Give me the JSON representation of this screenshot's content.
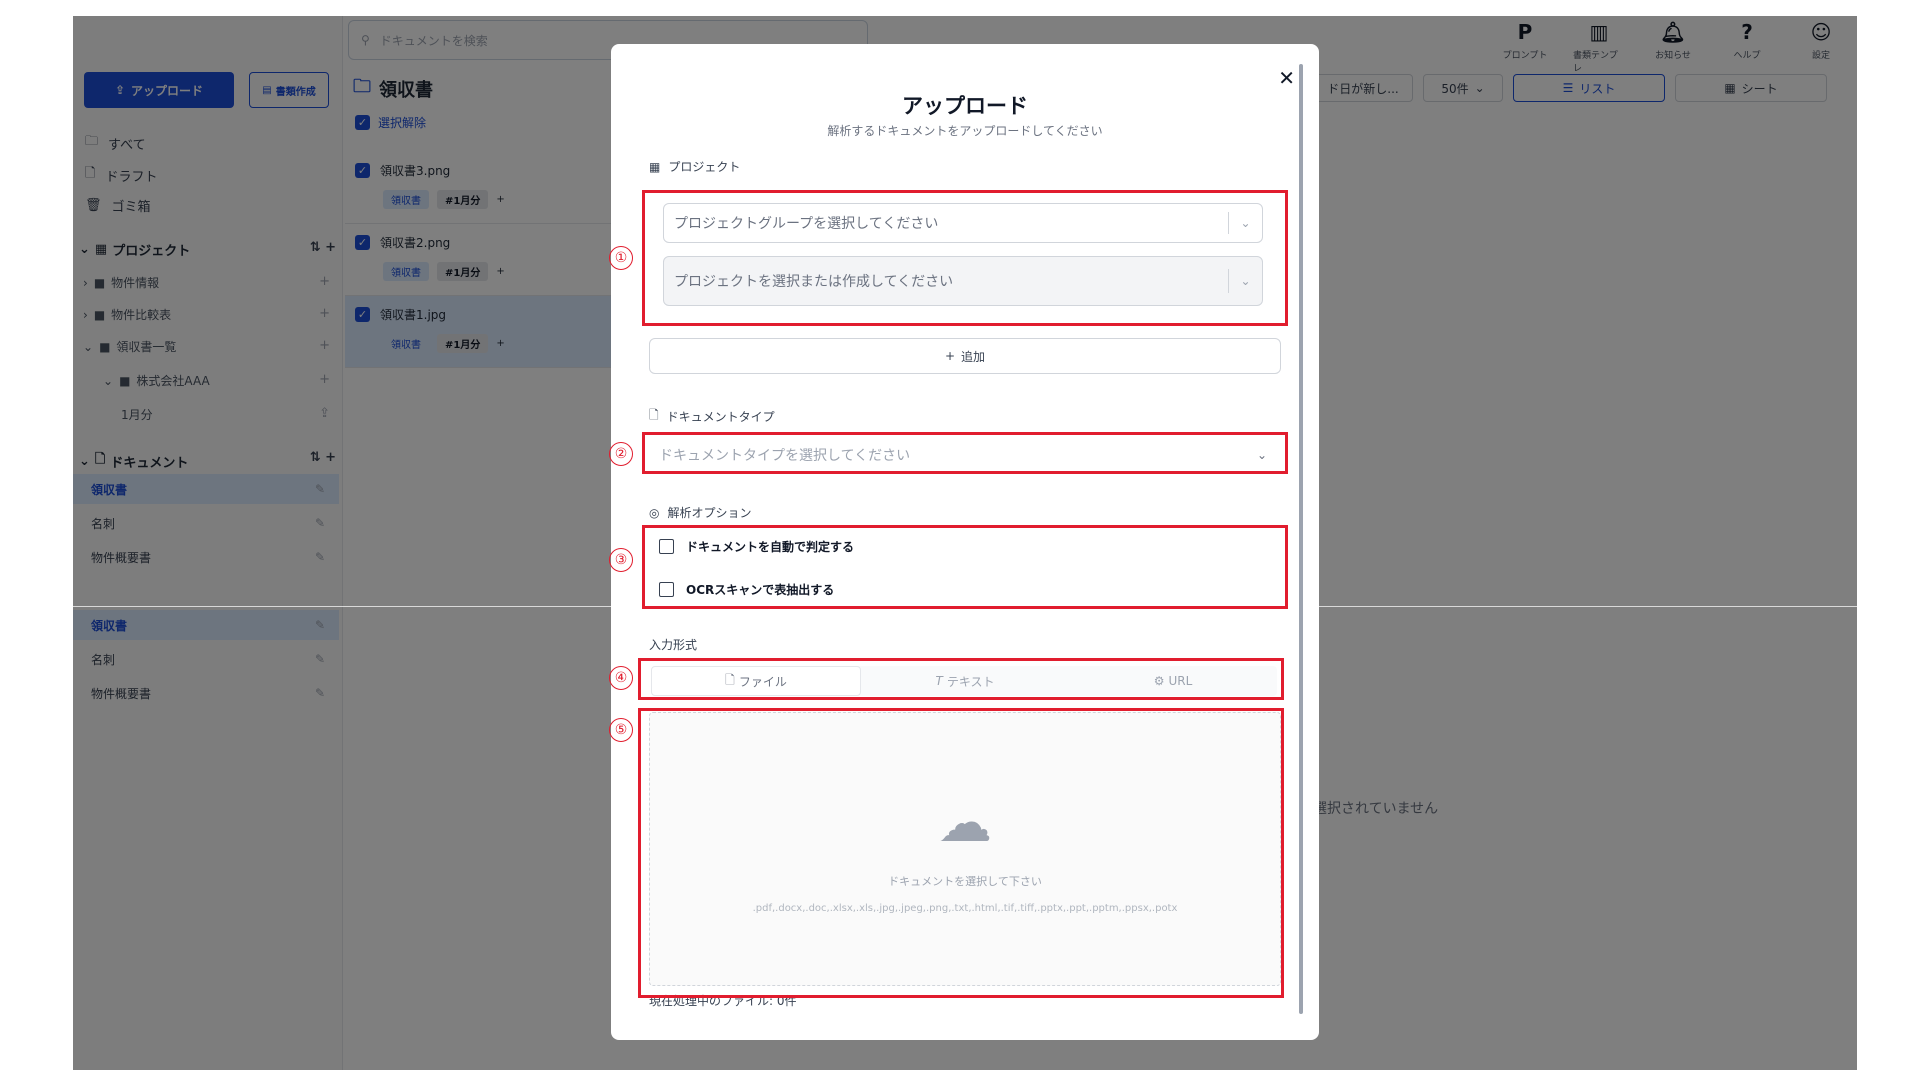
{
  "sidebar": {
    "upload_label": "アップロード",
    "create_label": "書類作成",
    "nav": [
      {
        "label": "すべて",
        "icon": "folder-icon"
      },
      {
        "label": "ドラフト",
        "icon": "file-icon"
      },
      {
        "label": "ゴミ箱",
        "icon": "trash-icon"
      }
    ],
    "projects_header": "プロジェクト",
    "projects_actions": "⇅ +",
    "tree": [
      {
        "label": "物件情報"
      },
      {
        "label": "物件比較表"
      },
      {
        "label": "領収書一覧"
      },
      {
        "label": "株式会社AAA"
      },
      {
        "label": "1月分"
      }
    ],
    "documents_header": "ドキュメント",
    "documents_actions": "⇅ +",
    "documents": [
      {
        "label": "領収書"
      },
      {
        "label": "名刺"
      },
      {
        "label": "物件概要書"
      }
    ],
    "documents_dup": [
      {
        "label": "領収書"
      },
      {
        "label": "名刺"
      },
      {
        "label": "物件概要書"
      }
    ]
  },
  "search": {
    "placeholder": "ドキュメントを検索"
  },
  "middle": {
    "folder_title": "領収書",
    "deselect_label": "選択解除",
    "files": [
      {
        "name": "領収書3.png",
        "tag1": "領収書",
        "tag2": "#1月分",
        "plus": "+"
      },
      {
        "name": "領収書2.png",
        "tag1": "領収書",
        "tag2": "#1月分",
        "plus": "+"
      },
      {
        "name": "領収書1.jpg",
        "tag1": "領収書",
        "tag2": "#1月分",
        "plus": "+"
      }
    ]
  },
  "topbar": {
    "icons": [
      {
        "label": "プロンプト",
        "glyph": "P",
        "icon": "prompt-icon"
      },
      {
        "label": "書類テンプレ",
        "glyph": "▥",
        "icon": "template-icon"
      },
      {
        "label": "お知らせ",
        "glyph": "🔔︎",
        "icon": "bell-icon"
      },
      {
        "label": "ヘルプ",
        "glyph": "?",
        "icon": "help-icon"
      },
      {
        "label": "設定",
        "glyph": "☺",
        "icon": "user-icon"
      }
    ],
    "sort_label": "ド日が新し...",
    "per_page": "50件",
    "view_list": "リスト",
    "view_sheet": "シート"
  },
  "empty_state": {
    "text": "選択されていません"
  },
  "dialog": {
    "title": "アップロード",
    "subtitle": "解析するドキュメントをアップロードしてください",
    "project_label": "プロジェクト",
    "project_group_placeholder": "プロジェクトグループを選択してください",
    "project_placeholder": "プロジェクトを選択または作成してください",
    "add_label": "追加",
    "doc_type_label": "ドキュメントタイプ",
    "doc_type_placeholder": "ドキュメントタイプを選択してください",
    "analysis_label": "解析オプション",
    "options": [
      {
        "label": "ドキュメントを自動で判定する",
        "checked": false
      },
      {
        "label": "OCRスキャンで表抽出する",
        "checked": false
      }
    ],
    "input_format_label": "入力形式",
    "tabs": [
      {
        "label": "ファイル",
        "icon": "file-icon",
        "active": true
      },
      {
        "label": "テキスト",
        "icon": "text-icon",
        "active": false
      },
      {
        "label": "URL",
        "icon": "link-icon",
        "active": false
      }
    ],
    "drop_text": "ドキュメントを選択して下さい",
    "file_types": ".pdf,.docx,.doc,.xlsx,.xls,.jpg,.jpeg,.png,.txt,.html,.tif,.tiff,.pptx,.ppt,.pptm,.ppsx,.potx",
    "processing": "現在処理中のファイル: 0件"
  },
  "annotations": [
    "①",
    "②",
    "③",
    "④",
    "⑤"
  ],
  "colors": {
    "accent": "#1d4ed8",
    "annotation": "#e11d2e",
    "overlay": "rgba(0,0,0,0.5)"
  }
}
